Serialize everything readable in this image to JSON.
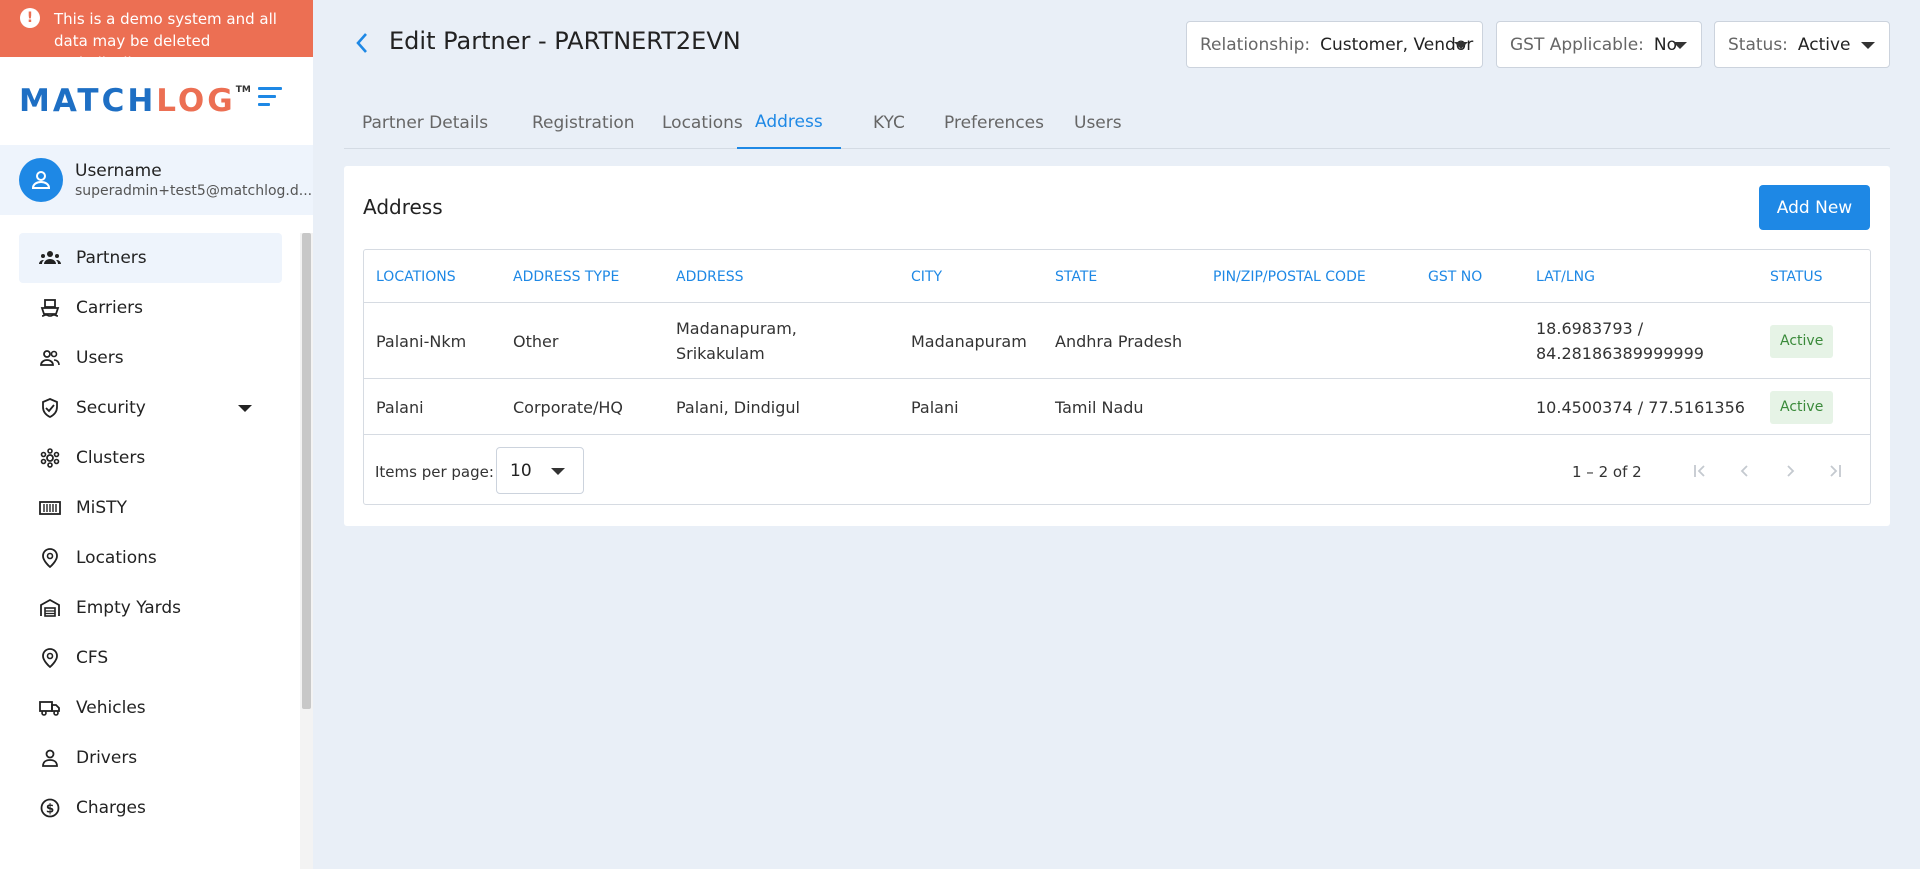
{
  "banner": {
    "text": "This is a demo system and all data may be deleted periodically"
  },
  "logo": {
    "part1": "MATCH",
    "part2": "LOG",
    "tm": "TM"
  },
  "user": {
    "name": "Username",
    "email": "superadmin+test5@matchlog.d..."
  },
  "sidebar": {
    "items": [
      {
        "label": "Partners",
        "icon": "partners-icon",
        "active": true
      },
      {
        "label": "Carriers",
        "icon": "ship-icon"
      },
      {
        "label": "Users",
        "icon": "users-icon"
      },
      {
        "label": "Security",
        "icon": "shield-icon",
        "expandable": true
      },
      {
        "label": "Clusters",
        "icon": "cluster-icon"
      },
      {
        "label": "MiSTY",
        "icon": "container-icon"
      },
      {
        "label": "Locations",
        "icon": "location-pin-icon"
      },
      {
        "label": "Empty Yards",
        "icon": "warehouse-icon"
      },
      {
        "label": "CFS",
        "icon": "location-pin-icon"
      },
      {
        "label": "Vehicles",
        "icon": "truck-icon"
      },
      {
        "label": "Drivers",
        "icon": "person-icon"
      },
      {
        "label": "Charges",
        "icon": "dollar-icon"
      }
    ]
  },
  "header": {
    "title": "Edit Partner - PARTNERT2EVN",
    "relationship": {
      "label": "Relationship:",
      "value": "Customer, Vendor"
    },
    "gst": {
      "label": "GST Applicable:",
      "value": "No"
    },
    "status": {
      "label": "Status:",
      "value": "Active"
    }
  },
  "tabs": [
    {
      "label": "Partner Details"
    },
    {
      "label": "Registration"
    },
    {
      "label": "Locations"
    },
    {
      "label": "Address",
      "active": true
    },
    {
      "label": "KYC"
    },
    {
      "label": "Preferences"
    },
    {
      "label": "Users"
    }
  ],
  "card": {
    "title": "Address",
    "add_label": "Add New",
    "columns": [
      "LOCATIONS",
      "ADDRESS TYPE",
      "ADDRESS",
      "CITY",
      "STATE",
      "PIN/ZIP/POSTAL CODE",
      "GST NO",
      "LAT/LNG",
      "STATUS"
    ],
    "rows": [
      {
        "location": "Palani-Nkm",
        "type": "Other",
        "address1": "Madanapuram,",
        "address2": "Srikakulam",
        "city": "Madanapuram",
        "state": "Andhra Pradesh",
        "pin": "",
        "gst": "",
        "latlng1": "18.6983793 /",
        "latlng2": "84.28186389999999",
        "status": "Active"
      },
      {
        "location": "Palani",
        "type": "Corporate/HQ",
        "address1": "Palani, Dindigul",
        "address2": "",
        "city": "Palani",
        "state": "Tamil Nadu",
        "pin": "",
        "gst": "",
        "latlng1": "10.4500374 / 77.5161356",
        "latlng2": "",
        "status": "Active"
      }
    ],
    "pager": {
      "label": "Items per page:",
      "size": "10",
      "range": "1 – 2 of 2"
    }
  },
  "colors": {
    "accent": "#1e88e5",
    "banner": "#ec6f53",
    "active_badge_bg": "#e6f3e6",
    "active_badge_fg": "#3a8a3a"
  }
}
